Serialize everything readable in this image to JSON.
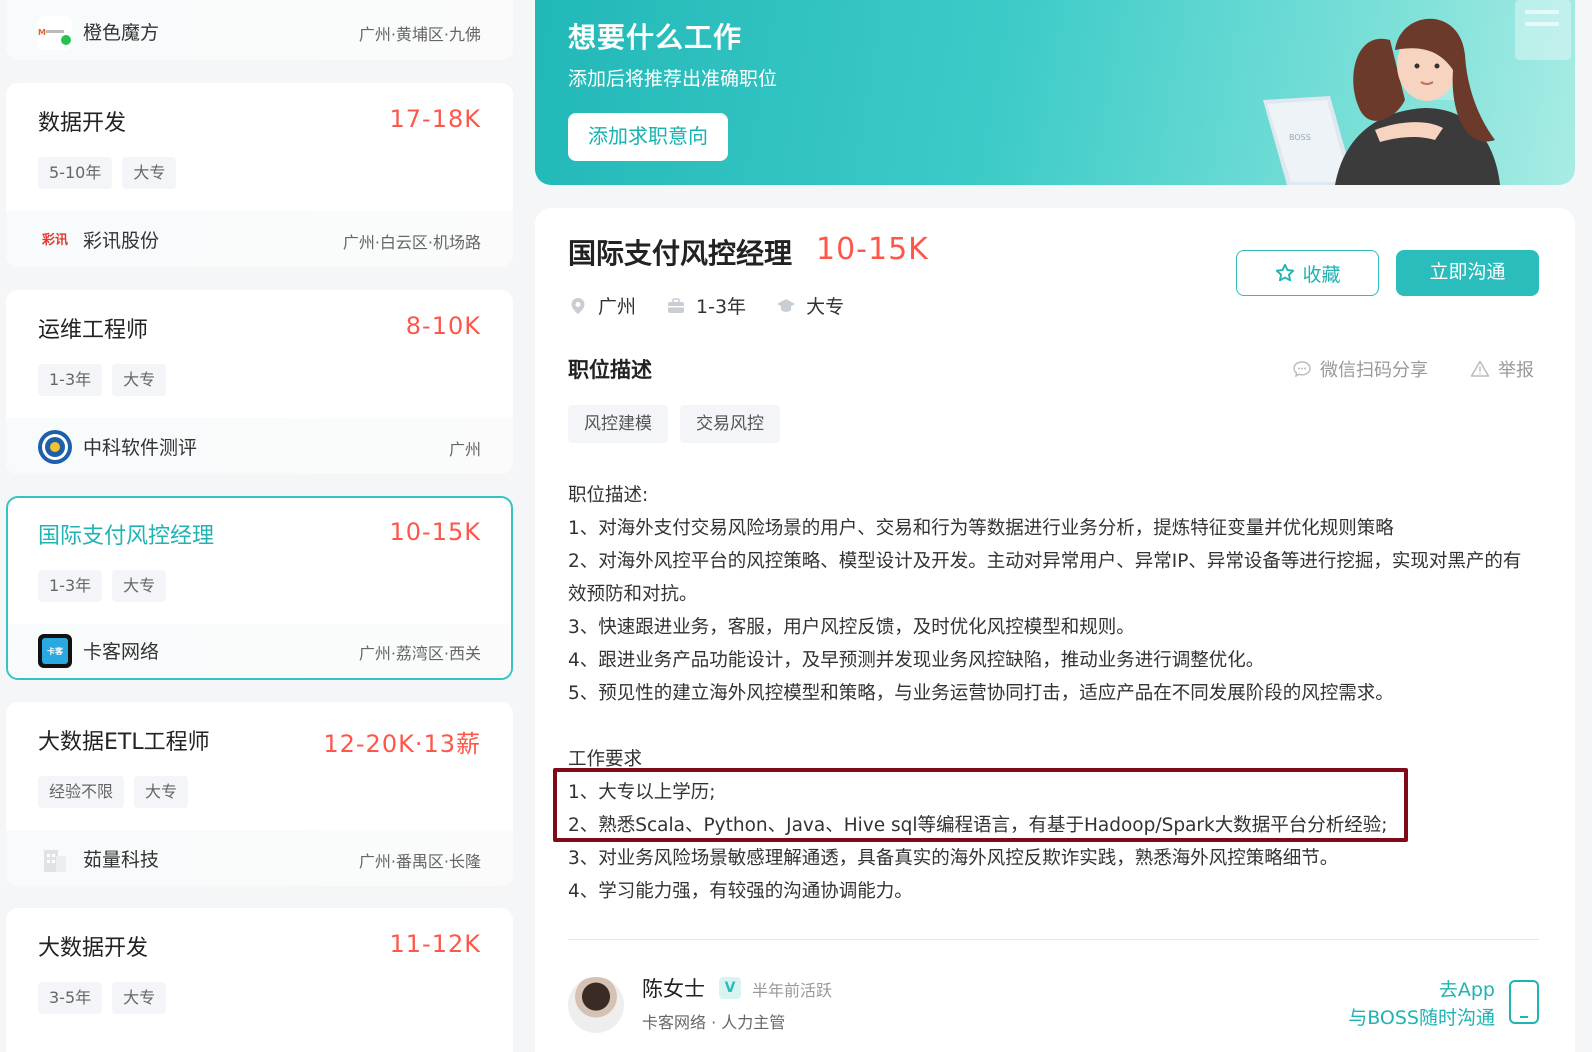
{
  "job_list": [
    {
      "title": "",
      "salary": "",
      "tags": [],
      "company": "橙色魔方",
      "location": "广州·黄埔区·九佛",
      "logo_text": "",
      "partial": true
    },
    {
      "title": "数据开发",
      "salary": "17-18K",
      "tags": [
        "5-10年",
        "大专"
      ],
      "company": "彩讯股份",
      "location": "广州·白云区·机场路",
      "logo_text": "彩讯"
    },
    {
      "title": "运维工程师",
      "salary": "8-10K",
      "tags": [
        "1-3年",
        "大专"
      ],
      "company": "中科软件测评",
      "location": "广州",
      "logo_text": ""
    },
    {
      "title": "国际支付风控经理",
      "salary": "10-15K",
      "tags": [
        "1-3年",
        "大专"
      ],
      "company": "卡客网络",
      "location": "广州·荔湾区·西关",
      "logo_text": "卡客",
      "active": true
    },
    {
      "title": "大数据ETL工程师",
      "salary": "12-20K·13薪",
      "tags": [
        "经验不限",
        "大专"
      ],
      "company": "茹量科技",
      "location": "广州·番禺区·长隆",
      "logo_text": ""
    },
    {
      "title": "大数据开发",
      "salary": "11-12K",
      "tags": [
        "3-5年",
        "大专"
      ],
      "company": "",
      "location": "",
      "logo_text": ""
    }
  ],
  "banner": {
    "title": "想要什么工作",
    "subtitle": "添加后将推荐出准确职位",
    "button": "添加求职意向"
  },
  "detail": {
    "title": "国际支付风控经理",
    "salary": "10-15K",
    "city": "广州",
    "experience": "1-3年",
    "education": "大专",
    "fav_label": "收藏",
    "chat_label": "立即沟通",
    "section_title": "职位描述",
    "share_label": "微信扫码分享",
    "report_label": "举报",
    "skill_tags": [
      "风控建模",
      "交易风控"
    ],
    "description_lines": [
      "职位描述:",
      "1、对海外支付交易风险场景的用户、交易和行为等数据进行业务分析，提炼特征变量并优化规则策略",
      "2、对海外风控平台的风控策略、模型设计及开发。主动对异常用户、异常IP、异常设备等进行挖掘，实现对黑产的有效预防和对抗。",
      "3、快速跟进业务，客服，用户风控反馈，及时优化风控模型和规则。",
      "4、跟进业务产品功能设计，及早预测并发现业务风控缺陷，推动业务进行调整优化。",
      "5、预见性的建立海外风控模型和策略，与业务运营协同打击，适应产品在不同发展阶段的风控需求。",
      "",
      "工作要求",
      "1、大专以上学历;",
      "2、熟悉Scala、Python、Java、Hive sql等编程语言，有基于Hadoop/Spark大数据平台分析经验;",
      "3、对业务风险场景敏感理解通透，具备真实的海外风控反欺诈实践，熟悉海外风控策略细节。",
      "4、学习能力强，有较强的沟通协调能力。"
    ]
  },
  "recruiter": {
    "name": "陈女士",
    "verify_badge": "V",
    "active_status": "半年前活跃",
    "company_role": "卡客网络 · 人力主管",
    "app_line1": "去App",
    "app_line2": "与BOSS随时沟通"
  },
  "colors": {
    "accent": "#2bbcbc",
    "salary": "#fe574a",
    "highlight_box": "#7f0a18"
  }
}
